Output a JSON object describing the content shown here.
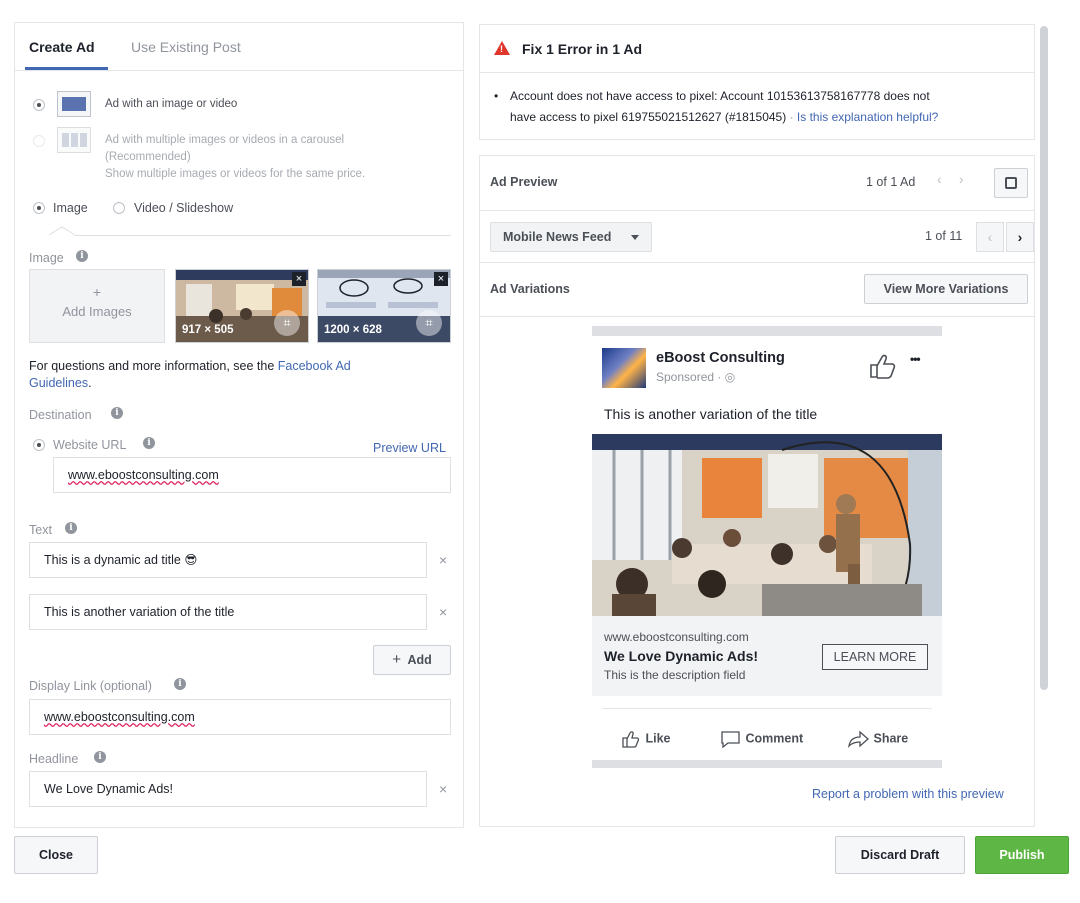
{
  "left": {
    "tabs": {
      "active": "Create Ad",
      "inactive": "Use Existing Post"
    },
    "formats": {
      "single": "Ad with an image or video",
      "carousel_title": "Ad with multiple images or videos in a carousel",
      "carousel_rec": "(Recommended)",
      "carousel_desc": "Show multiple images or videos for the same price."
    },
    "media": {
      "image": "Image",
      "video": "Video / Slideshow"
    },
    "image_section": {
      "label": "Image",
      "add_plus": "+",
      "add_label": "Add Images",
      "thumbs": [
        {
          "size": "917 × 505"
        },
        {
          "size": "1200 × 628"
        }
      ]
    },
    "info_text": "For questions and more information, see the",
    "info_link_1": "Facebook Ad",
    "info_link_2": "Guidelines",
    "info_period": ".",
    "destination": {
      "label": "Destination",
      "website_label": "Website URL",
      "preview_link": "Preview URL",
      "url_value": "www.eboostconsulting.com"
    },
    "text_section": {
      "label": "Text",
      "values": [
        "This is a dynamic ad title 😎",
        "This is another variation of the title"
      ],
      "add_label": "Add",
      "add_plus": "+"
    },
    "display_link": {
      "label": "Display Link (optional)",
      "value": "www.eboostconsulting.com"
    },
    "headline": {
      "label": "Headline",
      "value": "We Love Dynamic Ads!"
    },
    "remove_glyph": "×",
    "info_glyph": "i"
  },
  "error": {
    "title": "Fix 1 Error in 1 Ad",
    "bullet": "•",
    "line1": "Account does not have access to pixel: Account 10153613758167778 does not",
    "line2": "have access to pixel 619755021512627 (#1815045)",
    "sep": "·",
    "helpful_link": "Is this explanation helpful?"
  },
  "preview": {
    "title": "Ad Preview",
    "count": "1 of 1 Ad",
    "placement": "Mobile News Feed",
    "placement_count": "1 of 11",
    "variations_label": "Ad Variations",
    "view_more": "View More Variations",
    "report_link": "Report a problem with this preview",
    "chev_left": "‹",
    "chev_right": "›"
  },
  "ad": {
    "page_name": "eBoost Consulting",
    "sponsored": "Sponsored · ",
    "globe": "◎",
    "more": "•••",
    "title_text": "This is another variation of the title",
    "link_url": "www.eboostconsulting.com",
    "link_headline": "We Love Dynamic Ads!",
    "link_desc": "This is the description field",
    "cta": "LEARN MORE",
    "actions": {
      "like": "Like",
      "comment": "Comment",
      "share": "Share"
    }
  },
  "footer": {
    "close": "Close",
    "discard": "Discard Draft",
    "publish": "Publish"
  },
  "colors": {
    "accent": "#4267b2",
    "publish": "#5eb744",
    "error": "#e0352b"
  }
}
